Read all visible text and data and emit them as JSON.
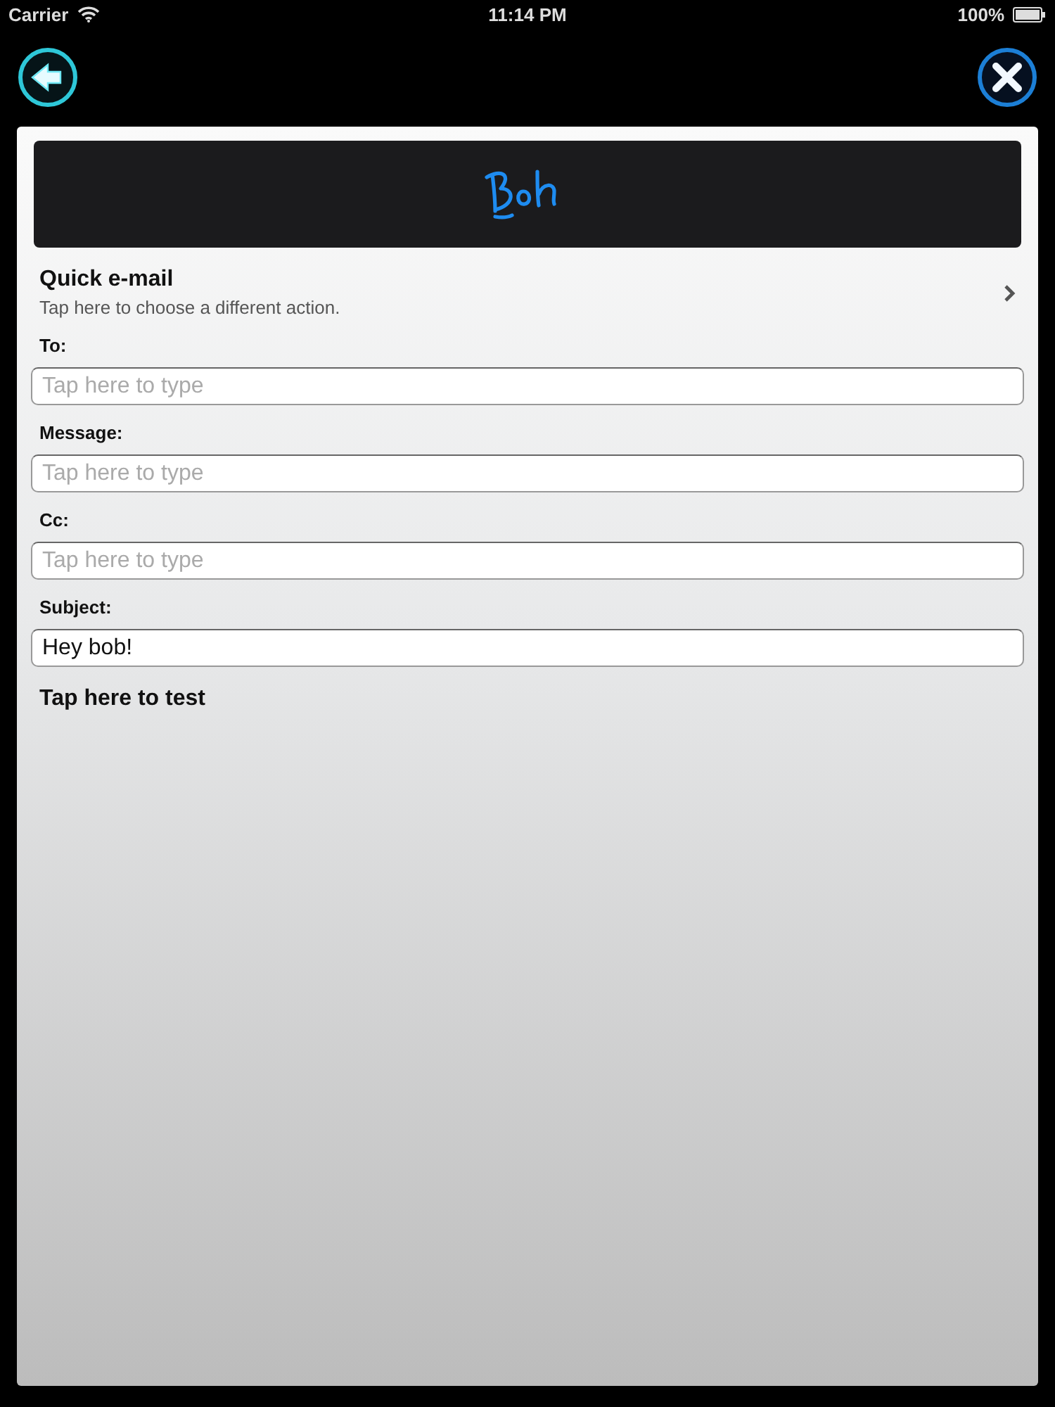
{
  "status_bar": {
    "carrier": "Carrier",
    "time": "11:14 PM",
    "battery": "100%"
  },
  "action": {
    "title": "Quick e-mail",
    "subtitle": "Tap here to choose a different action."
  },
  "fields": [
    {
      "label": "To:",
      "placeholder": "Tap here to type"
    },
    {
      "label": "Message:",
      "placeholder": "Tap here to type"
    },
    {
      "label": "Cc:",
      "placeholder": "Tap here to type"
    },
    {
      "label": "Subject:",
      "value": "Hey bob!"
    }
  ],
  "test_link": "Tap here to test"
}
